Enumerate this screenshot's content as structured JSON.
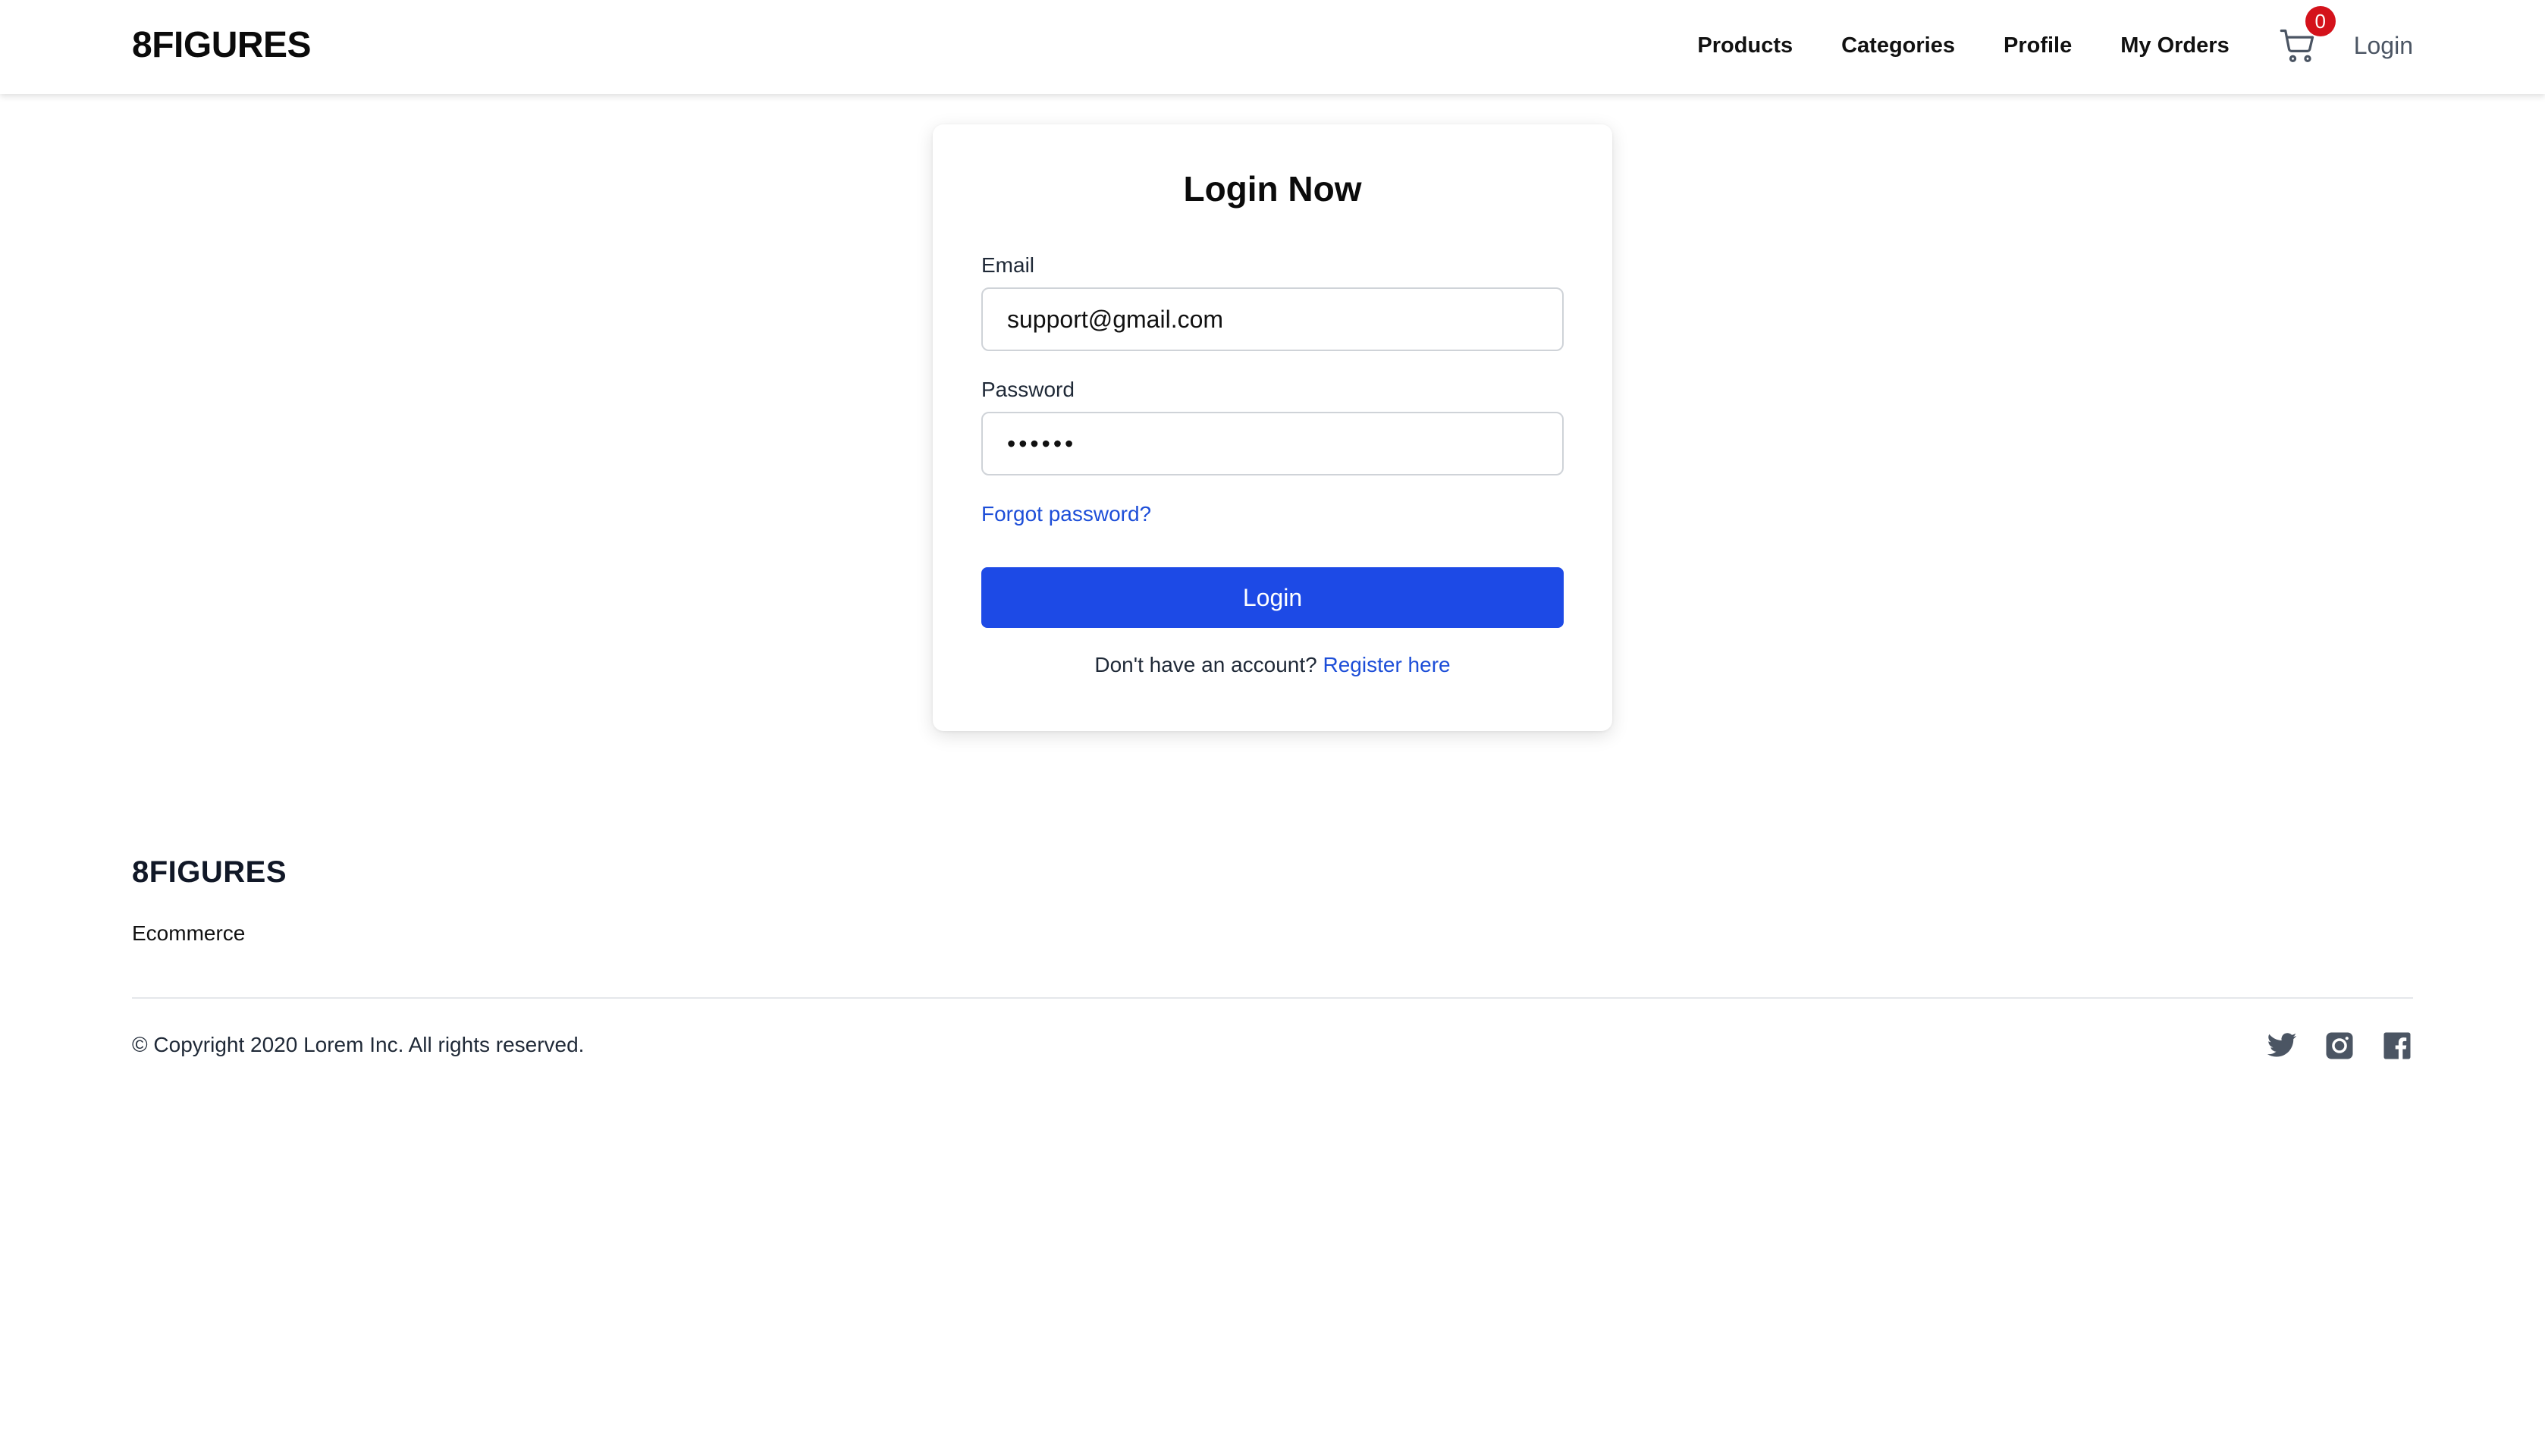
{
  "header": {
    "brand": "8FIGURES",
    "nav": {
      "products": "Products",
      "categories": "Categories",
      "profile": "Profile",
      "my_orders": "My Orders",
      "login": "Login"
    },
    "cart": {
      "icon": "cart-icon",
      "count": "0",
      "badge_color": "#d4121b"
    }
  },
  "login_form": {
    "title": "Login Now",
    "email_label": "Email",
    "email_value": "support@gmail.com",
    "password_label": "Password",
    "password_value": "••••••",
    "forgot_password": "Forgot password?",
    "submit_label": "Login",
    "register_prompt": "Don't have an account?",
    "register_link": "Register here"
  },
  "footer": {
    "brand": "8FIGURES",
    "tagline": "Ecommerce",
    "copyright": "© Copyright 2020 Lorem Inc. All rights reserved.",
    "socials": [
      "twitter-icon",
      "instagram-icon",
      "facebook-icon"
    ]
  },
  "colors": {
    "primary": "#1d4ae6",
    "link": "#1d4ed8",
    "text": "#111111",
    "muted": "#4b5563"
  }
}
